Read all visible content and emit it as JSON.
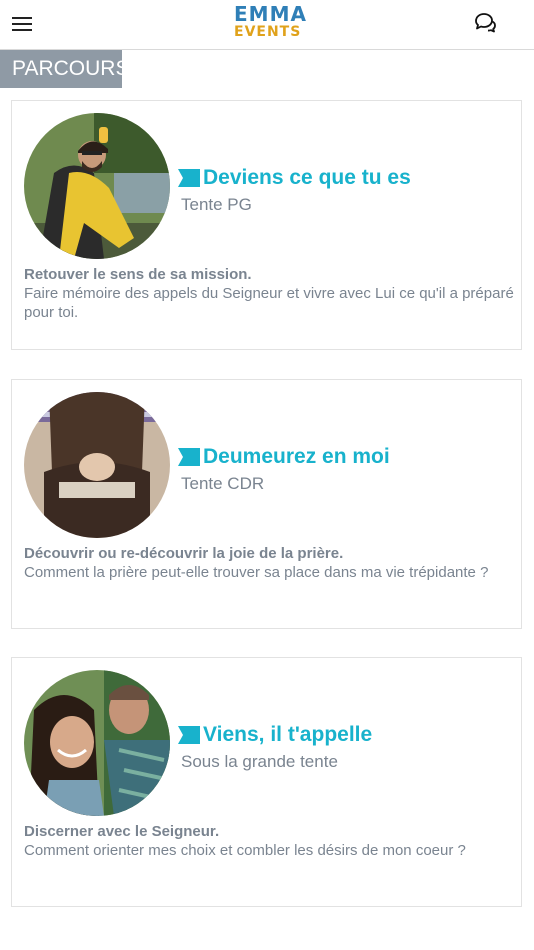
{
  "header": {
    "logo_top": "EMMA",
    "logo_bottom": "EVENTS",
    "menu_icon": "hamburger-menu-icon",
    "chat_icon": "chat-bubbles-icon"
  },
  "section": {
    "title": "PARCOURS"
  },
  "cards": [
    {
      "title": "Deviens ce que tu es",
      "subtitle": "Tente PG",
      "lead": "Retouver le sens de sa mission.",
      "text": "Faire mémoire des appels du Seigneur et vivre avec Lui ce qu'il a préparé pour toi."
    },
    {
      "title": "Deumeurez en moi",
      "subtitle": "Tente CDR",
      "lead": "Découvrir ou re-découvrir la joie de la prière.",
      "text": "Comment la prière peut-elle trouver sa place dans ma vie trépidante ?"
    },
    {
      "title": "Viens, il t'appelle",
      "subtitle": "Sous la grande tente",
      "lead": "Discerner avec le Seigneur.",
      "text": "Comment orienter mes choix et combler les désirs de mon coeur ?"
    }
  ],
  "colors": {
    "accent": "#18b2cc",
    "tag_bg": "#8f9aa5",
    "logo_blue": "#2f7fb7",
    "logo_gold": "#e0a21b"
  }
}
